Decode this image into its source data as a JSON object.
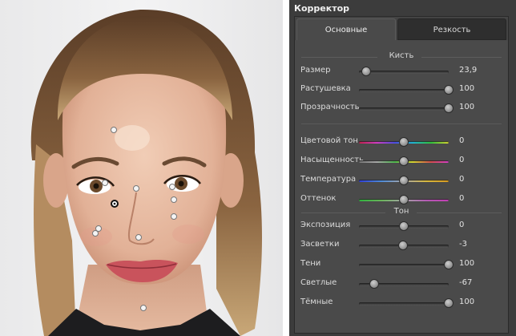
{
  "panel": {
    "title": "Корректор",
    "tabs": [
      {
        "label": "Основные",
        "active": true
      },
      {
        "label": "Резкость",
        "active": false
      }
    ]
  },
  "brush": {
    "header": "Кисть",
    "sliders": [
      {
        "label": "Размер",
        "value": "23,9",
        "level": 0.08
      },
      {
        "label": "Растушевка",
        "value": "100",
        "level": 1.0
      },
      {
        "label": "Прозрачность",
        "value": "100",
        "level": 1.0
      }
    ]
  },
  "color": {
    "sliders": [
      {
        "label": "Цветовой тон",
        "value": "0",
        "level": 0.5,
        "track": "hue"
      },
      {
        "label": "Насыщенность",
        "value": "0",
        "level": 0.5,
        "track": "saturation"
      },
      {
        "label": "Температура",
        "value": "0",
        "level": 0.5,
        "track": "temperature"
      },
      {
        "label": "Оттенок",
        "value": "0",
        "level": 0.5,
        "track": "tint"
      }
    ]
  },
  "tone": {
    "header": "Тон",
    "sliders": [
      {
        "label": "Экспозиция",
        "value": "0",
        "level": 0.5
      },
      {
        "label": "Засветки",
        "value": "-3",
        "level": 0.49
      },
      {
        "label": "Тени",
        "value": "100",
        "level": 1.0
      },
      {
        "label": "Светлые",
        "value": "-67",
        "level": 0.17
      },
      {
        "label": "Тёмные",
        "value": "100",
        "level": 1.0
      }
    ]
  },
  "photo": {
    "markers_count": 10,
    "selected_marker_index": 4
  },
  "colors": {
    "panel_bg": "#3c3c3c",
    "content_bg": "#4a4a4a",
    "text": "#dcdcdc"
  }
}
